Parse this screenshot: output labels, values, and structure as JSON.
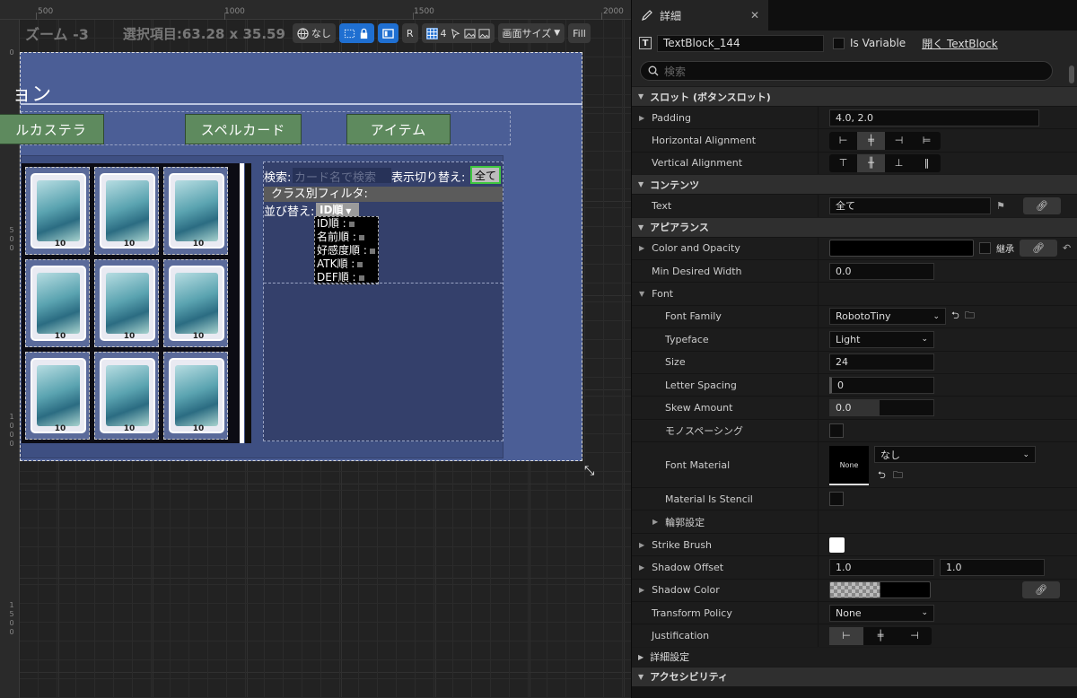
{
  "ruler_top": {
    "labels": [
      "500",
      "1000",
      "1500",
      "2000"
    ]
  },
  "ruler_left": {
    "labels": [
      "0",
      "500",
      "1000",
      "1500"
    ]
  },
  "toolbar": {
    "zoom": "ズーム -3",
    "selection": "選択項目:63.28 x 35.59",
    "locale_label": "なし",
    "r_label": "R",
    "grid_count": "4",
    "screen_size_label": "画面サイズ",
    "fill_label": "Fill"
  },
  "canvas": {
    "title": "ョン",
    "tabs": [
      "ルカステラ",
      "スペルカード",
      "アイテム"
    ],
    "card_count_label": "10",
    "search_label": "検索:",
    "search_placeholder": "カード名で検索",
    "display_toggle_label": "表示切り替え:",
    "all_button": "全て",
    "class_filter_label": "クラス別フィルタ:",
    "sort_label": "並び替え:",
    "sort_selected": "ID順",
    "sort_items": [
      "ID順 :",
      "名前順 :",
      "好感度順 :",
      "ATK順 :",
      "DEF順 :"
    ]
  },
  "details": {
    "tab_title": "詳細",
    "widget_name": "TextBlock_144",
    "is_variable_label": "Is Variable",
    "open_link": "開く TextBlock",
    "search_placeholder": "検索",
    "sections": {
      "slot": "スロット (ボタンスロット)",
      "content": "コンテンツ",
      "appearance": "アピアランス",
      "advanced": "詳細設定",
      "accessibility": "アクセシビリティ"
    },
    "props": {
      "padding": {
        "label": "Padding",
        "value": "4.0, 2.0"
      },
      "h_align": {
        "label": "Horizontal Alignment"
      },
      "v_align": {
        "label": "Vertical Alignment"
      },
      "text": {
        "label": "Text",
        "value": "全て"
      },
      "color_opacity": {
        "label": "Color and Opacity",
        "inherit": "継承"
      },
      "min_width": {
        "label": "Min Desired Width",
        "value": "0.0"
      },
      "font": {
        "label": "Font"
      },
      "font_family": {
        "label": "Font Family",
        "value": "RobotoTiny"
      },
      "typeface": {
        "label": "Typeface",
        "value": "Light"
      },
      "size": {
        "label": "Size",
        "value": "24"
      },
      "letter_spacing": {
        "label": "Letter Spacing",
        "value": "0"
      },
      "skew": {
        "label": "Skew Amount",
        "value": "0.0"
      },
      "monospacing": {
        "label": "モノスペーシング"
      },
      "font_material": {
        "label": "Font Material",
        "thumb": "None",
        "value": "なし"
      },
      "material_stencil": {
        "label": "Material Is Stencil"
      },
      "outline": {
        "label": "輪郭設定"
      },
      "strike_brush": {
        "label": "Strike Brush"
      },
      "shadow_offset": {
        "label": "Shadow Offset",
        "x": "1.0",
        "y": "1.0"
      },
      "shadow_color": {
        "label": "Shadow Color"
      },
      "transform_policy": {
        "label": "Transform Policy",
        "value": "None"
      },
      "justification": {
        "label": "Justification"
      }
    },
    "colors": {
      "accent": "#1f6fd1",
      "panel": "#1c1c1c",
      "section": "#2f2f2f"
    }
  }
}
